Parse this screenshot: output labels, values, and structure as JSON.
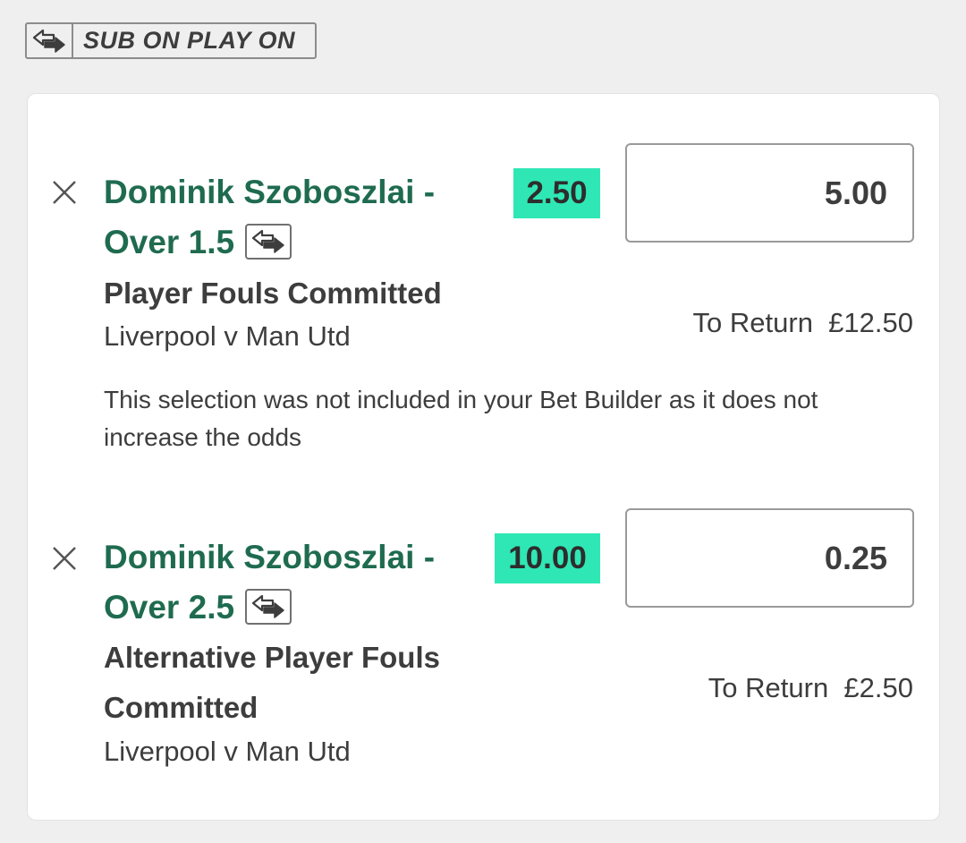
{
  "sub_badge": {
    "label": "SUB ON PLAY ON",
    "icon": "substitution-arrows-icon"
  },
  "selections": [
    {
      "title_line1": "Dominik Szoboszlai -",
      "title_line2": "Over 1.5",
      "odds": "2.50",
      "stake": "5.00",
      "market": "Player Fouls Committed",
      "event": "Liverpool v Man Utd",
      "to_return_label": "To Return",
      "to_return_value": "£12.50",
      "note": "This selection was not included in your Bet Builder as it does not increase the odds"
    },
    {
      "title_line1": "Dominik Szoboszlai -",
      "title_line2": "Over 2.5",
      "odds": "10.00",
      "stake": "0.25",
      "market_line1": "Alternative Player Fouls",
      "market_line2": "Committed",
      "event": "Liverpool v Man Utd",
      "to_return_label": "To Return",
      "to_return_value": "£2.50"
    }
  ],
  "colors": {
    "title_green": "#1f6b50",
    "odds_highlight": "#2fe7b4",
    "background": "#efefef"
  }
}
